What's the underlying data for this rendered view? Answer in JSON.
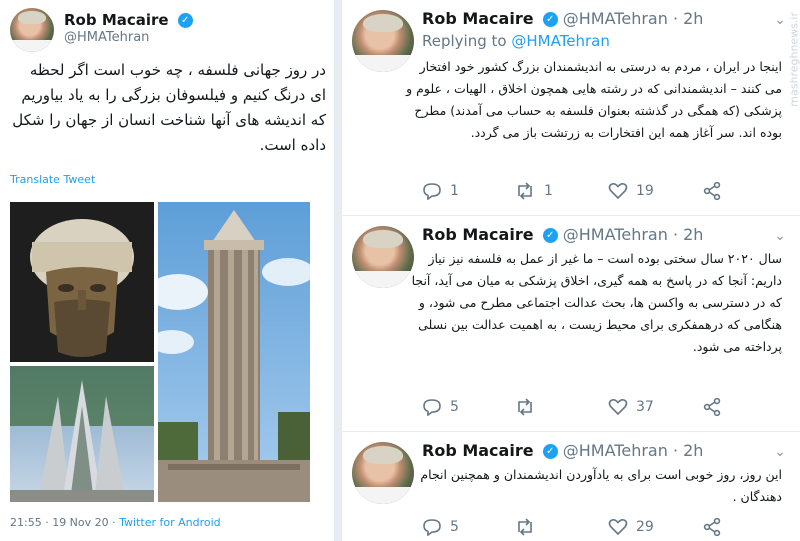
{
  "left_tweet": {
    "name": "Rob Macaire",
    "handle": "@HMATehran",
    "text": "در روز جهانی فلسفه ، چه خوب است اگر لحظه ای درنگ کنیم و فیلسوفان بزرگی را به یاد بیاوریم که اندیشه های آنها شناخت انسان از جهان را شکل داده است.",
    "translate": "Translate Tweet",
    "timestamp": "21:55 · 19 Nov 20 · ",
    "source": "Twitter for Android"
  },
  "tweets": [
    {
      "name": "Rob Macaire",
      "handle": "@HMATehran",
      "time": "· 2h",
      "replying_label": "Replying to ",
      "replying_handle": "@HMATehran",
      "text": "اینجا در ایران ، مردم به درستی به اندیشمندان بزرگ کشور خود افتخار می کنند – اندیشمندانی که در رشته هایی همچون اخلاق ، الهیات ، علوم و پزشکی (که همگی در گذشته بعنوان فلسفه به حساب می آمدند) مطرح بوده اند. سر آغاز همه این افتخارات به زرتشت باز می گردد.",
      "replies": "1",
      "retweets": "1",
      "likes": "19"
    },
    {
      "name": "Rob Macaire",
      "handle": "@HMATehran",
      "time": "· 2h",
      "text": "سال ۲۰۲۰ سال سختی بوده است – ما غیر از عمل به فلسفه نیز نیاز داریم: آنجا که در پاسخ به همه گیری، اخلاق پزشکی به میان می آید، آنجا که در دسترسی به واکسن ها، بحث عدالت اجتماعی مطرح می شود، و هنگامی که درهمفکری برای محیط زیست ، به اهمیت عدالت بین نسلی پرداخته می شود.",
      "replies": "5",
      "retweets": "",
      "likes": "37"
    },
    {
      "name": "Rob Macaire",
      "handle": "@HMATehran",
      "time": "· 2h",
      "text": "این روز، روز خوبی است برای به یادآوردن اندیشمندان و همچنین انجام دهندگان .",
      "replies": "5",
      "retweets": "",
      "likes": "29"
    }
  ],
  "watermark": "mashreghnews.ir",
  "colors": {
    "accent": "#1da1f2",
    "muted": "#657786",
    "border": "#e6ecf0"
  }
}
